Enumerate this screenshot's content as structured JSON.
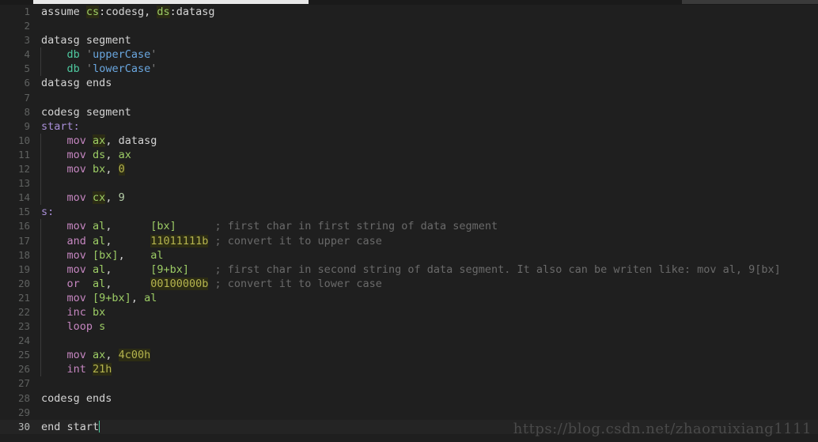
{
  "editor": {
    "language": "assembly",
    "theme_background": "#1f1f1f",
    "total_lines": 30,
    "active_line": 30,
    "scrollbar": {
      "orientation": "horizontal",
      "position": "top"
    },
    "colors": {
      "background": "#1f1f1f",
      "line_number": "#5f6160",
      "line_number_active": "#b8bbba",
      "keyword": "#c586c0",
      "register": "#9ccc65",
      "string": "#6aa7e0",
      "comment": "#6a6a6a",
      "label": "#a98fd8",
      "directive_db": "#4ec9a0",
      "number_highlight_bg": "#2c2c14",
      "caret": "#4ec9a0"
    }
  },
  "watermark": {
    "text": "https://blog.csdn.net/zhaoruixiang1111"
  },
  "lines": [
    {
      "n": "1",
      "indent": false,
      "tokens": [
        {
          "t": "assume ",
          "c": "t-dir"
        },
        {
          "t": "cs",
          "c": "t-reg-hl"
        },
        {
          "t": ":",
          "c": "t-plain"
        },
        {
          "t": "codesg",
          "c": "t-plain"
        },
        {
          "t": ", ",
          "c": "t-plain"
        },
        {
          "t": "ds",
          "c": "t-reg-hl"
        },
        {
          "t": ":",
          "c": "t-plain"
        },
        {
          "t": "datasg",
          "c": "t-plain"
        }
      ]
    },
    {
      "n": "2",
      "indent": false,
      "tokens": []
    },
    {
      "n": "3",
      "indent": false,
      "tokens": [
        {
          "t": "datasg segment",
          "c": "t-seg"
        }
      ]
    },
    {
      "n": "4",
      "indent": true,
      "tokens": [
        {
          "t": "    ",
          "c": "t-plain"
        },
        {
          "t": "db",
          "c": "t-db"
        },
        {
          "t": " ",
          "c": "t-plain"
        },
        {
          "t": "'",
          "c": "t-quote"
        },
        {
          "t": "upperCase",
          "c": "t-str"
        },
        {
          "t": "'",
          "c": "t-quote"
        }
      ]
    },
    {
      "n": "5",
      "indent": true,
      "tokens": [
        {
          "t": "    ",
          "c": "t-plain"
        },
        {
          "t": "db",
          "c": "t-db"
        },
        {
          "t": " ",
          "c": "t-plain"
        },
        {
          "t": "'",
          "c": "t-quote"
        },
        {
          "t": "lowerCase",
          "c": "t-str"
        },
        {
          "t": "'",
          "c": "t-quote"
        }
      ]
    },
    {
      "n": "6",
      "indent": false,
      "tokens": [
        {
          "t": "datasg ends",
          "c": "t-seg"
        }
      ]
    },
    {
      "n": "7",
      "indent": false,
      "tokens": []
    },
    {
      "n": "8",
      "indent": false,
      "tokens": [
        {
          "t": "codesg segment",
          "c": "t-seg"
        }
      ]
    },
    {
      "n": "9",
      "indent": false,
      "tokens": [
        {
          "t": "start:",
          "c": "t-label"
        }
      ]
    },
    {
      "n": "10",
      "indent": true,
      "tokens": [
        {
          "t": "    ",
          "c": "t-plain"
        },
        {
          "t": "mov",
          "c": "t-kw"
        },
        {
          "t": " ",
          "c": "t-plain"
        },
        {
          "t": "ax",
          "c": "t-reg-hl"
        },
        {
          "t": ", datasg",
          "c": "t-plain"
        }
      ]
    },
    {
      "n": "11",
      "indent": true,
      "tokens": [
        {
          "t": "    ",
          "c": "t-plain"
        },
        {
          "t": "mov",
          "c": "t-kw"
        },
        {
          "t": " ",
          "c": "t-plain"
        },
        {
          "t": "ds",
          "c": "t-reg"
        },
        {
          "t": ", ",
          "c": "t-plain"
        },
        {
          "t": "ax",
          "c": "t-reg"
        }
      ]
    },
    {
      "n": "12",
      "indent": true,
      "tokens": [
        {
          "t": "    ",
          "c": "t-plain"
        },
        {
          "t": "mov",
          "c": "t-kw"
        },
        {
          "t": " ",
          "c": "t-plain"
        },
        {
          "t": "bx",
          "c": "t-reg"
        },
        {
          "t": ", ",
          "c": "t-plain"
        },
        {
          "t": "0",
          "c": "t-num-hl"
        }
      ]
    },
    {
      "n": "13",
      "indent": true,
      "tokens": []
    },
    {
      "n": "14",
      "indent": true,
      "tokens": [
        {
          "t": "    ",
          "c": "t-plain"
        },
        {
          "t": "mov",
          "c": "t-kw"
        },
        {
          "t": " ",
          "c": "t-plain"
        },
        {
          "t": "cx",
          "c": "t-reg-hl"
        },
        {
          "t": ", ",
          "c": "t-plain"
        },
        {
          "t": "9",
          "c": "t-num"
        }
      ]
    },
    {
      "n": "15",
      "indent": false,
      "tokens": [
        {
          "t": "s:",
          "c": "t-label"
        }
      ]
    },
    {
      "n": "16",
      "indent": true,
      "tokens": [
        {
          "t": "    ",
          "c": "t-plain"
        },
        {
          "t": "mov",
          "c": "t-kw"
        },
        {
          "t": " ",
          "c": "t-plain"
        },
        {
          "t": "al",
          "c": "t-reg"
        },
        {
          "t": ",      ",
          "c": "t-plain"
        },
        {
          "t": "[bx]",
          "c": "t-reg"
        },
        {
          "t": "      ",
          "c": "t-plain"
        },
        {
          "t": "; first char in first string of data segment",
          "c": "t-comment"
        }
      ]
    },
    {
      "n": "17",
      "indent": true,
      "tokens": [
        {
          "t": "    ",
          "c": "t-plain"
        },
        {
          "t": "and",
          "c": "t-kw"
        },
        {
          "t": " ",
          "c": "t-plain"
        },
        {
          "t": "al",
          "c": "t-reg"
        },
        {
          "t": ",      ",
          "c": "t-plain"
        },
        {
          "t": "11011111b",
          "c": "t-num-hl"
        },
        {
          "t": " ",
          "c": "t-plain"
        },
        {
          "t": "; convert it to upper case",
          "c": "t-comment"
        }
      ]
    },
    {
      "n": "18",
      "indent": true,
      "tokens": [
        {
          "t": "    ",
          "c": "t-plain"
        },
        {
          "t": "mov",
          "c": "t-kw"
        },
        {
          "t": " ",
          "c": "t-plain"
        },
        {
          "t": "[bx]",
          "c": "t-reg"
        },
        {
          "t": ",    ",
          "c": "t-plain"
        },
        {
          "t": "al",
          "c": "t-reg"
        }
      ]
    },
    {
      "n": "19",
      "indent": true,
      "tokens": [
        {
          "t": "    ",
          "c": "t-plain"
        },
        {
          "t": "mov",
          "c": "t-kw"
        },
        {
          "t": " ",
          "c": "t-plain"
        },
        {
          "t": "al",
          "c": "t-reg"
        },
        {
          "t": ",      ",
          "c": "t-plain"
        },
        {
          "t": "[9+bx]",
          "c": "t-reg"
        },
        {
          "t": "    ",
          "c": "t-plain"
        },
        {
          "t": "; first char in second string of data segment. It also can be writen like: mov al, 9[bx]",
          "c": "t-comment"
        }
      ]
    },
    {
      "n": "20",
      "indent": true,
      "tokens": [
        {
          "t": "    ",
          "c": "t-plain"
        },
        {
          "t": "or",
          "c": "t-kw"
        },
        {
          "t": "  ",
          "c": "t-plain"
        },
        {
          "t": "al",
          "c": "t-reg"
        },
        {
          "t": ",      ",
          "c": "t-plain"
        },
        {
          "t": "00100000b",
          "c": "t-num-hl"
        },
        {
          "t": " ",
          "c": "t-plain"
        },
        {
          "t": "; convert it to lower case",
          "c": "t-comment"
        }
      ]
    },
    {
      "n": "21",
      "indent": true,
      "tokens": [
        {
          "t": "    ",
          "c": "t-plain"
        },
        {
          "t": "mov",
          "c": "t-kw"
        },
        {
          "t": " ",
          "c": "t-plain"
        },
        {
          "t": "[9+bx]",
          "c": "t-reg"
        },
        {
          "t": ", ",
          "c": "t-plain"
        },
        {
          "t": "al",
          "c": "t-reg"
        }
      ]
    },
    {
      "n": "22",
      "indent": true,
      "tokens": [
        {
          "t": "    ",
          "c": "t-plain"
        },
        {
          "t": "inc",
          "c": "t-kw"
        },
        {
          "t": " ",
          "c": "t-plain"
        },
        {
          "t": "bx",
          "c": "t-reg"
        }
      ]
    },
    {
      "n": "23",
      "indent": true,
      "tokens": [
        {
          "t": "    ",
          "c": "t-plain"
        },
        {
          "t": "loop",
          "c": "t-kw"
        },
        {
          "t": " ",
          "c": "t-plain"
        },
        {
          "t": "s",
          "c": "t-reg"
        }
      ]
    },
    {
      "n": "24",
      "indent": true,
      "tokens": []
    },
    {
      "n": "25",
      "indent": true,
      "tokens": [
        {
          "t": "    ",
          "c": "t-plain"
        },
        {
          "t": "mov",
          "c": "t-kw"
        },
        {
          "t": " ",
          "c": "t-plain"
        },
        {
          "t": "ax",
          "c": "t-reg"
        },
        {
          "t": ", ",
          "c": "t-plain"
        },
        {
          "t": "4c00h",
          "c": "t-num-hl"
        }
      ]
    },
    {
      "n": "26",
      "indent": true,
      "tokens": [
        {
          "t": "    ",
          "c": "t-plain"
        },
        {
          "t": "int",
          "c": "t-kw"
        },
        {
          "t": " ",
          "c": "t-plain"
        },
        {
          "t": "21h",
          "c": "t-num-hl"
        }
      ]
    },
    {
      "n": "27",
      "indent": false,
      "tokens": []
    },
    {
      "n": "28",
      "indent": false,
      "tokens": [
        {
          "t": "codesg ends",
          "c": "t-seg"
        }
      ]
    },
    {
      "n": "29",
      "indent": false,
      "tokens": []
    },
    {
      "n": "30",
      "indent": false,
      "active": true,
      "caret": true,
      "tokens": [
        {
          "t": "end start",
          "c": "t-seg"
        }
      ]
    }
  ]
}
